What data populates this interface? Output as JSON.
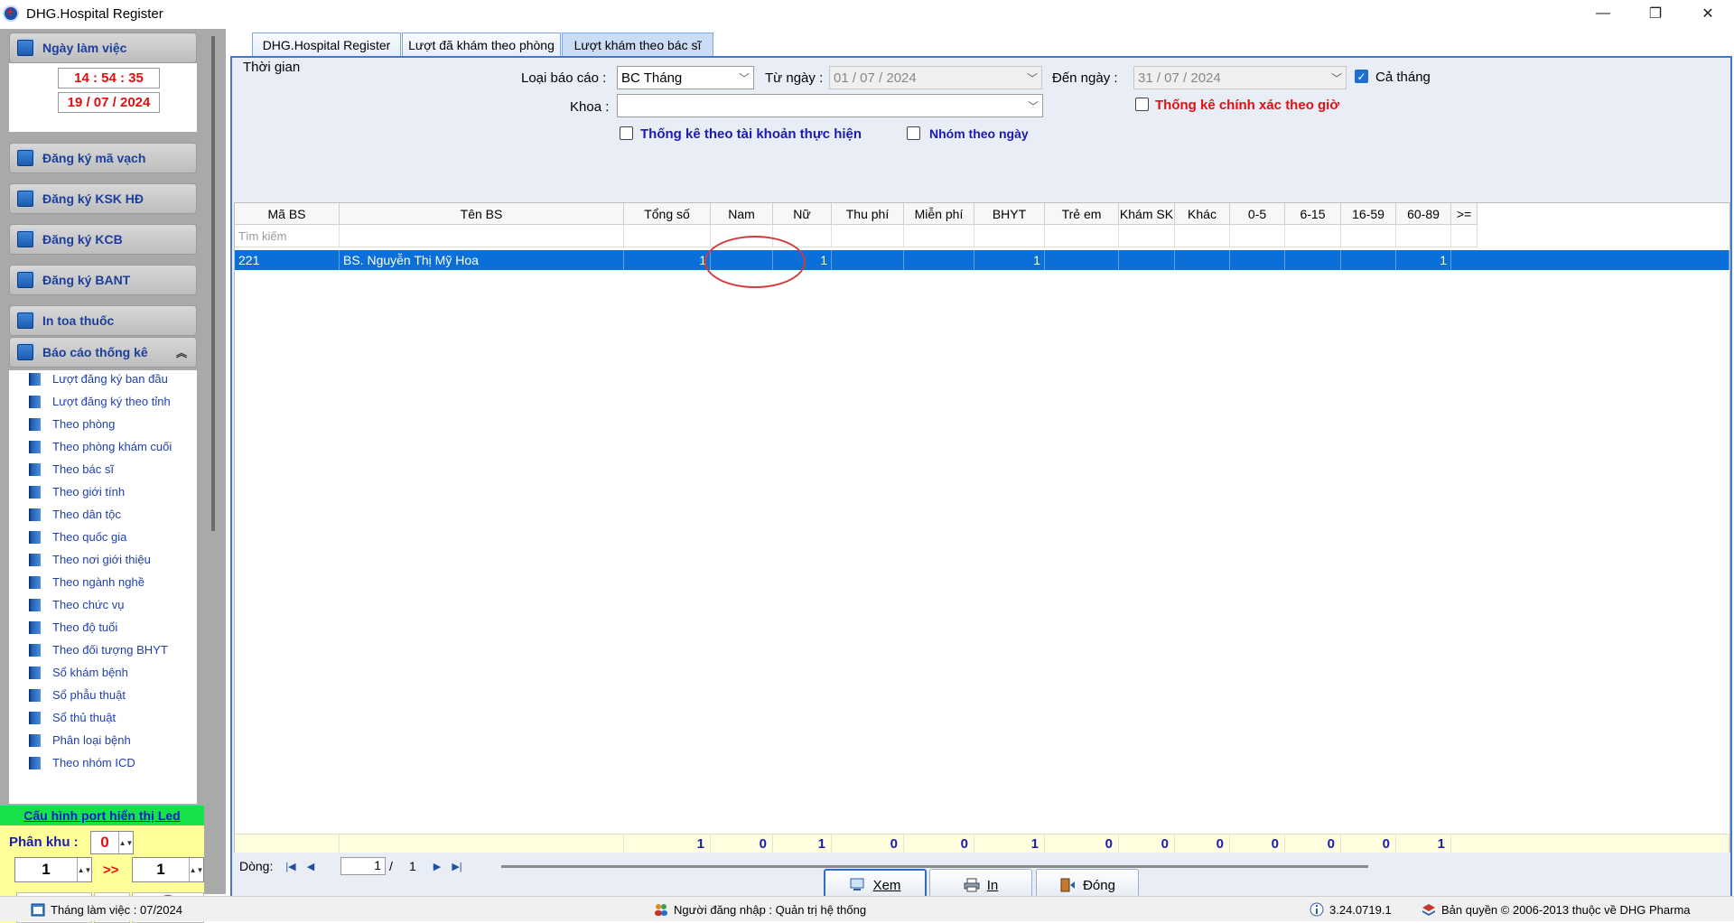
{
  "window": {
    "title": "DHG.Hospital Register",
    "minimize": "—",
    "restore": "❐",
    "close": "✕"
  },
  "sidebar": {
    "workday_header": "Ngày làm việc",
    "time": "14 : 54 : 35",
    "date": "19 / 07 / 2024",
    "groups": [
      "Đăng ký mã vạch",
      "Đăng ký KSK HĐ",
      "Đăng ký KCB",
      "Đăng ký BANT",
      "In toa thuốc",
      "Báo cáo thống kê"
    ],
    "report_items": [
      "Lượt đăng ký ban đầu",
      "Lượt đăng ký theo tỉnh",
      "Theo phòng",
      "Theo phòng khám cuối",
      "Theo bác sĩ",
      "Theo giới tính",
      "Theo dân tộc",
      "Theo quốc gia",
      "Theo nơi giới thiệu",
      "Theo ngành nghề",
      "Theo chức vụ",
      "Theo độ tuổi",
      "Theo đối tượng BHYT",
      "Sổ khám bệnh",
      "Sổ phẫu thuật",
      "Sổ thủ thuật",
      "Phân loại bệnh",
      "Theo nhóm ICD"
    ],
    "led_config": "Cấu hình port hiển thị Led",
    "zone_label": "Phân khu :",
    "zone_value": "0",
    "from_value": "1",
    "arrow": ">>",
    "to_value": "1"
  },
  "tabs": [
    "DHG.Hospital Register",
    "Lượt đã khám theo phòng",
    "Lượt khám theo bác sĩ"
  ],
  "filters": {
    "group_title": "Thời gian",
    "report_type_label": "Loại báo cáo :",
    "report_type_value": "BC Tháng",
    "from_label": "Từ ngày :",
    "from_value": "01 / 07 / 2024",
    "to_label": "Đến ngày :",
    "to_value": "31 / 07 / 2024",
    "whole_month_label": "Cả tháng",
    "exact_hour_label": "Thống kê chính xác theo giờ",
    "dept_label": "Khoa :",
    "dept_value": "",
    "by_account_label": "Thống kê theo tài khoản thực hiện",
    "group_by_day_label": "Nhóm theo ngày"
  },
  "grid": {
    "columns": [
      "Mã BS",
      "Tên BS",
      "Tổng số",
      "Nam",
      "Nữ",
      "Thu phí",
      "Miễn phí",
      "BHYT",
      "Trẻ em",
      "Khám SK",
      "Khác",
      "0-5",
      "6-15",
      "16-59",
      "60-89",
      ">="
    ],
    "search_placeholder": "Tìm kiếm",
    "row": [
      "221",
      "BS. Nguyễn Thị Mỹ Hoa",
      "1",
      "",
      "1",
      "",
      "",
      "1",
      "",
      "",
      "",
      "",
      "",
      "",
      "1",
      ""
    ],
    "totals": [
      "",
      "",
      "1",
      "0",
      "1",
      "0",
      "0",
      "1",
      "0",
      "0",
      "0",
      "0",
      "0",
      "0",
      "1",
      ""
    ]
  },
  "pager": {
    "label": "Dòng:",
    "current": "1",
    "sep": "/",
    "total": "1"
  },
  "actions": {
    "view": "Xem",
    "print": "In",
    "close": "Đóng"
  },
  "status": {
    "month": "Tháng làm việc : 07/2024",
    "user": "Người đăng nhập : Quản trị hệ thống",
    "version": "3.24.0719.1",
    "copyright": "Bản quyền © 2006-2013 thuộc về DHG Pharma"
  }
}
